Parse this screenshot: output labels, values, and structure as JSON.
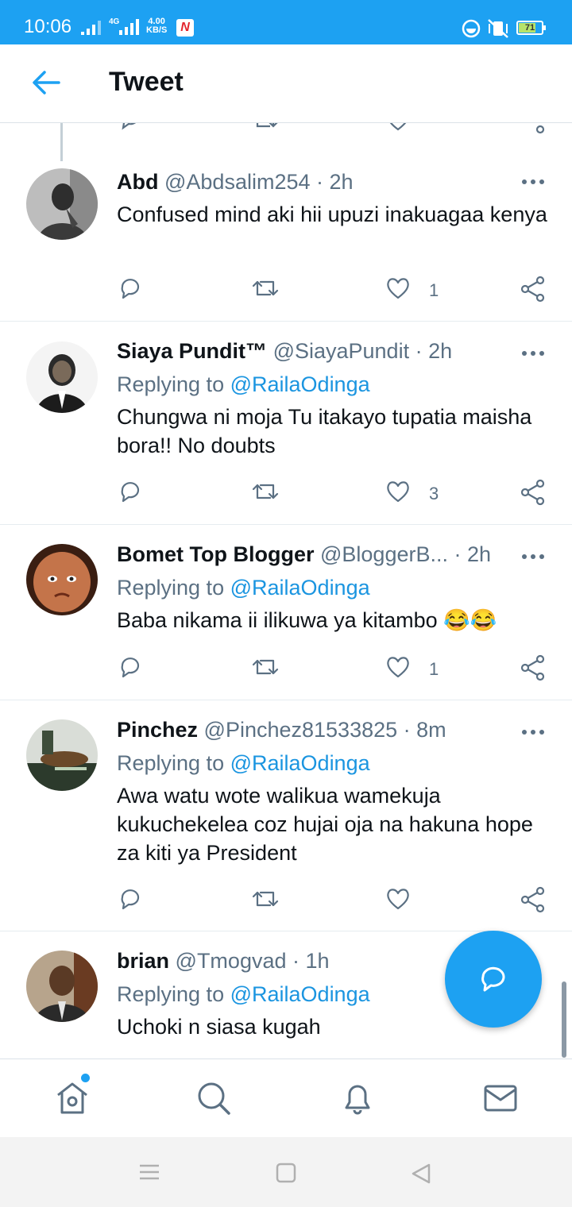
{
  "status_bar": {
    "time": "10:06",
    "network": "4G",
    "speed_value": "4.00",
    "speed_unit": "KB/S",
    "notification_badge": "N",
    "battery": "71"
  },
  "header": {
    "title": "Tweet",
    "back_icon": "arrow-left-icon"
  },
  "tweets": [
    {
      "name": "Abd",
      "handle": "@Abdsalim254",
      "time": "· 2h",
      "replying_label": "",
      "replying_to": "",
      "text": "Confused mind aki hii upuzi inakuagaa kenya",
      "likes": "1"
    },
    {
      "name": "Siaya Pundit™",
      "handle": "@SiayaPundit",
      "time": "· 2h",
      "replying_label": "Replying to",
      "replying_to": "@RailaOdinga",
      "text": "Chungwa ni moja Tu itakayo tupatia maisha bora!! No doubts",
      "likes": "3"
    },
    {
      "name": "Bomet Top Blogger",
      "handle": "@BloggerB...",
      "time": "· 2h",
      "replying_label": "Replying to",
      "replying_to": "@RailaOdinga",
      "text": "Baba nikama ii ilikuwa ya kitambo 😂😂",
      "likes": "1"
    },
    {
      "name": "Pinchez",
      "handle": "@Pinchez81533825",
      "time": "· 8m",
      "replying_label": "Replying to",
      "replying_to": "@RailaOdinga",
      "text": "Awa watu wote walikua wamekuja kukuchekelea coz hujai oja na hakuna hope za kiti ya President",
      "likes": ""
    },
    {
      "name": "brian",
      "handle": "@Tmogvad",
      "time": "· 1h",
      "replying_label": "Replying to",
      "replying_to": "@RailaOdinga",
      "text": "Uchoki n siasa kugah",
      "likes": ""
    }
  ],
  "fab": {
    "icon": "compose-reply-icon"
  },
  "bottom_nav": [
    {
      "name": "home",
      "icon": "home-icon"
    },
    {
      "name": "search",
      "icon": "search-icon"
    },
    {
      "name": "notifications",
      "icon": "bell-icon"
    },
    {
      "name": "messages",
      "icon": "mail-icon"
    }
  ],
  "colors": {
    "accent": "#1da1f2",
    "mention": "#1b95e0",
    "secondary_text": "#5b7083",
    "primary_text": "#0f1419"
  }
}
